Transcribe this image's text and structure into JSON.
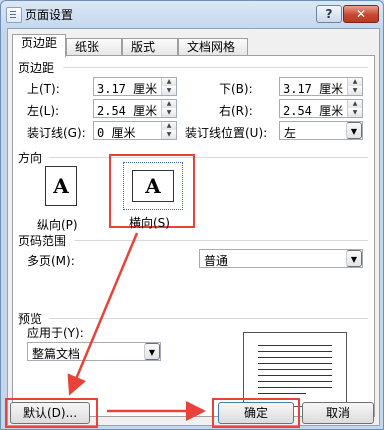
{
  "window": {
    "title": "页面设置",
    "help": "?",
    "close": "✕"
  },
  "tabs": [
    {
      "label": "页边距",
      "active": true
    },
    {
      "label": "纸张",
      "active": false
    },
    {
      "label": "版式",
      "active": false
    },
    {
      "label": "文档网格",
      "active": false
    }
  ],
  "margins": {
    "section": "页边距",
    "top": {
      "label": "上(T):",
      "value": "3.17 厘米"
    },
    "bottom": {
      "label": "下(B):",
      "value": "3.17 厘米"
    },
    "left": {
      "label": "左(L):",
      "value": "2.54 厘米"
    },
    "right": {
      "label": "右(R):",
      "value": "2.54 厘米"
    },
    "gutter": {
      "label": "装订线(G):",
      "value": "0 厘米"
    },
    "gutter_pos": {
      "label": "装订线位置(U):",
      "value": "左"
    }
  },
  "orientation": {
    "section": "方向",
    "portrait": {
      "label": "纵向(P)",
      "glyph": "A"
    },
    "landscape": {
      "label": "横向(S)",
      "glyph": "A",
      "selected": true
    }
  },
  "pages": {
    "section": "页码范围",
    "multi_label": "多页(M):",
    "multi_value": "普通"
  },
  "preview": {
    "section": "预览",
    "apply_label": "应用于(Y):",
    "apply_value": "整篇文档"
  },
  "buttons": {
    "default": "默认(D)...",
    "ok": "确定",
    "cancel": "取消"
  },
  "annotation_color": "#e8423a"
}
